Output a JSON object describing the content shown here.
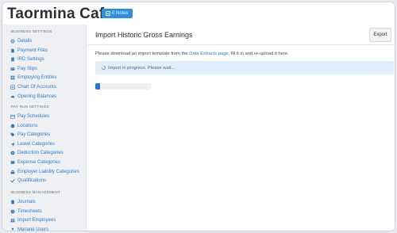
{
  "app": {
    "title": "Taormina Cafe",
    "notes_label": "0 Notes"
  },
  "sidebar": {
    "sections": [
      {
        "title": "BUSINESS SETTINGS",
        "items": [
          {
            "label": "Details",
            "icon": "gear-icon"
          },
          {
            "label": "Payment Files",
            "icon": "file-icon"
          },
          {
            "label": "IRD Settings",
            "icon": "building-icon"
          },
          {
            "label": "Pay Slips",
            "icon": "envelope-icon"
          },
          {
            "label": "Employing Entities",
            "icon": "grid-icon"
          },
          {
            "label": "Chart Of Accounts",
            "icon": "list-icon"
          },
          {
            "label": "Opening Balances",
            "icon": "gauge-icon"
          }
        ]
      },
      {
        "title": "PAY RUN SETTINGS",
        "items": [
          {
            "label": "Pay Schedules",
            "icon": "calendar-icon"
          },
          {
            "label": "Locations",
            "icon": "globe-icon"
          },
          {
            "label": "Pay Categories",
            "icon": "tags-icon"
          },
          {
            "label": "Leave Categories",
            "icon": "plane-icon"
          },
          {
            "label": "Deduction Categories",
            "icon": "minus-circle-icon"
          },
          {
            "label": "Expense Categories",
            "icon": "wallet-icon"
          },
          {
            "label": "Employer Liability Categories",
            "icon": "bank-icon"
          },
          {
            "label": "Qualifications",
            "icon": "check-icon"
          }
        ]
      },
      {
        "title": "BUSINESS MANAGEMENT",
        "items": [
          {
            "label": "Journals",
            "icon": "book-icon"
          },
          {
            "label": "Timesheets",
            "icon": "clock-icon"
          },
          {
            "label": "Import Employees",
            "icon": "users-icon"
          },
          {
            "label": "Manage Users",
            "icon": "user-icon"
          }
        ]
      }
    ]
  },
  "main": {
    "title": "Import Historic Gross Earnings",
    "export_label": "Export",
    "instruction_before": "Please download an import template from the ",
    "instruction_link": "Data Extracts page",
    "instruction_after": ", fill it in and re-upload it here.",
    "alert_text": "Import in progress. Please wait...",
    "progress_percent": 8
  },
  "colors": {
    "accent": "#2d8fe0",
    "link": "#2e7cc6",
    "alert_bg": "#e3eefb",
    "progress": "#2f6fd8"
  }
}
